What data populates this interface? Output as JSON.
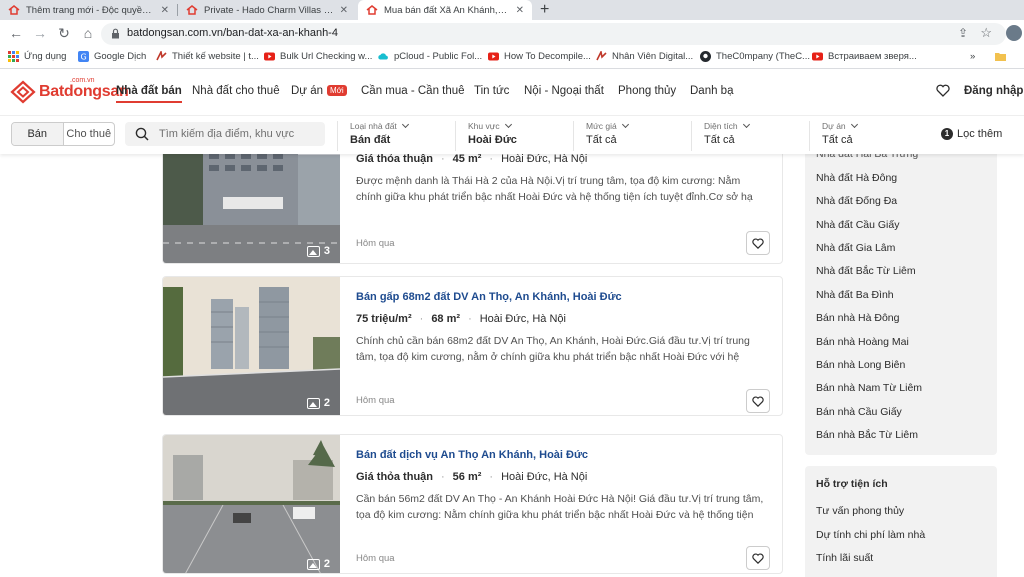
{
  "browser": {
    "tabs": [
      {
        "title": "Thêm trang mới - Độc quyền phá",
        "active": false
      },
      {
        "title": "Private - Hado Charm Villas - Độc",
        "active": false
      },
      {
        "title": "Mua bán đất Xã An Khánh, Huyệ",
        "active": true
      }
    ],
    "url": "batdongsan.com.vn/ban-dat-xa-an-khanh-4",
    "bookmarks": [
      {
        "label": "Ứng dụng",
        "icon": "apps-grid-icon"
      },
      {
        "label": "Google Dịch",
        "icon": "google-translate-icon"
      },
      {
        "label": "Thiết kế website | t...",
        "icon": "site-icon"
      },
      {
        "label": "Bulk Url Checking w...",
        "icon": "youtube-icon"
      },
      {
        "label": "pCloud - Public Fol...",
        "icon": "pcloud-icon"
      },
      {
        "label": "How To Decompile...",
        "icon": "youtube-icon"
      },
      {
        "label": "Nhân Viên Digital...",
        "icon": "site-icon"
      },
      {
        "label": "TheC0mpany (TheC...",
        "icon": "github-icon"
      },
      {
        "label": "Встраиваем зверя...",
        "icon": "youtube-icon"
      }
    ],
    "bookmarks_overflow": "»"
  },
  "site": {
    "brand": "Batdongsan",
    "brand_tld": ".com.vn",
    "menu": [
      {
        "label": "Nhà đất bán",
        "active": true
      },
      {
        "label": "Nhà đất cho thuê"
      },
      {
        "label": "Dự án",
        "badge": "Mới"
      },
      {
        "label": "Cần mua - Cần thuê"
      },
      {
        "label": "Tin tức"
      },
      {
        "label": "Nội - Ngoại thất"
      },
      {
        "label": "Phong thủy"
      },
      {
        "label": "Danh bạ"
      }
    ],
    "login_label": "Đăng nhập",
    "accent_color": "#e03c31"
  },
  "search": {
    "mode_buy": "Bán",
    "mode_rent": "Cho thuê",
    "placeholder": "Tìm kiếm địa điểm, khu vực",
    "filters": [
      {
        "label": "Loại nhà đất",
        "value": "Bán đất"
      },
      {
        "label": "Khu vực",
        "value": "Hoài Đức"
      },
      {
        "label": "Mức giá",
        "value": "Tất cả"
      },
      {
        "label": "Diện tích",
        "value": "Tất cả"
      },
      {
        "label": "Dự án",
        "value": "Tất cả"
      }
    ],
    "more_filters_count": "1",
    "more_filters_label": "Lọc thêm"
  },
  "listings": [
    {
      "title": "",
      "price": "Giá thỏa thuận",
      "area": "45 m²",
      "location": "Hoài Đức, Hà Nội",
      "description": "Được mệnh danh là Thái Hà 2 của Hà Nội.Vị trí trung tâm, tọa độ kim cương: Nằm chính giữa khu phát triển bậc nhất Hoài Đức và hệ thống tiện ích tuyệt đỉnh.Cơ sở hạ tầng hoàn...",
      "date": "Hôm qua",
      "photos": "3"
    },
    {
      "title": "Bán gấp 68m2 đất DV An Thọ, An Khánh, Hoài Đức",
      "price": "75 triệu/m²",
      "area": "68 m²",
      "location": "Hoài Đức, Hà Nội",
      "description": "Chính chủ cần bán 68m2 đất DV An Thọ, An Khánh, Hoài Đức.Giá đầu tư.Vị trí trung tâm, tọa độ kim cương, nằm ở chính giữa khu phát triển bậc nhất Hoài Đức với hệ thống giao...",
      "date": "Hôm qua",
      "photos": "2"
    },
    {
      "title": "Bán đất dịch vụ An Thọ An Khánh, Hoài Đức",
      "price": "Giá thỏa thuận",
      "area": "56 m²",
      "location": "Hoài Đức, Hà Nội",
      "description": "Cần bán 56m2 đất DV An Thọ - An Khánh Hoài Đức Hà Nội! Giá đầu tư.Vị trí trung tâm, tọa độ kim cương: Nằm chính giữa khu phát triển bậc nhất Hoài Đức và hệ thống tiện ích tuy...",
      "date": "Hôm qua",
      "photos": "2"
    }
  ],
  "sidebar": {
    "links": [
      "Nhà đất Hai Bà Trưng",
      "Nhà đất Hà Đông",
      "Nhà đất Đống Đa",
      "Nhà đất Cầu Giấy",
      "Nhà đất Gia Lâm",
      "Nhà đất Bắc Từ Liêm",
      "Nhà đất Ba Đình",
      "Bán nhà Hà Đông",
      "Bán nhà Hoàng Mai",
      "Bán nhà Long Biên",
      "Bán nhà Nam Từ Liêm",
      "Bán nhà Cầu Giấy",
      "Bán nhà Bắc Từ Liêm"
    ],
    "support_title": "Hỗ trợ tiện ích",
    "support_links": [
      "Tư vấn phong thủy",
      "Dự tính chi phí làm nhà",
      "Tính lãi suất"
    ]
  }
}
